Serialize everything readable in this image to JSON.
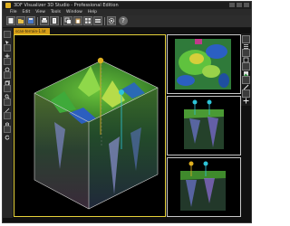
{
  "window": {
    "title": "3DF Visualizer 3D Studio - Professional Edition"
  },
  "menu": [
    "File",
    "Edit",
    "View",
    "Tools",
    "Window",
    "Help"
  ],
  "toolbar": {
    "buttons": [
      "new-icon",
      "open-icon",
      "save-icon",
      "print-icon",
      "document-icon",
      "copy-icon",
      "paste-icon",
      "grid-icon",
      "layers-icon",
      "gear-icon",
      "help-icon"
    ],
    "help_glyph": "?"
  },
  "document_tab": {
    "label": "scan-terrain-1.bt"
  },
  "left_tools": [
    "select-icon",
    "move-icon",
    "rotate-icon",
    "cube-icon",
    "zoom-icon",
    "wand-icon",
    "pan-icon",
    "reset-icon"
  ],
  "right_tools": [
    "list-icon",
    "view-icon",
    "image-icon",
    "edit-icon",
    "cross-icon"
  ],
  "colors": {
    "accent": "#d9a017",
    "viewport_border": "#e6d23a",
    "background": "#000000",
    "marker_yellow": "#e0b020",
    "marker_cyan": "#2ec4d8"
  }
}
